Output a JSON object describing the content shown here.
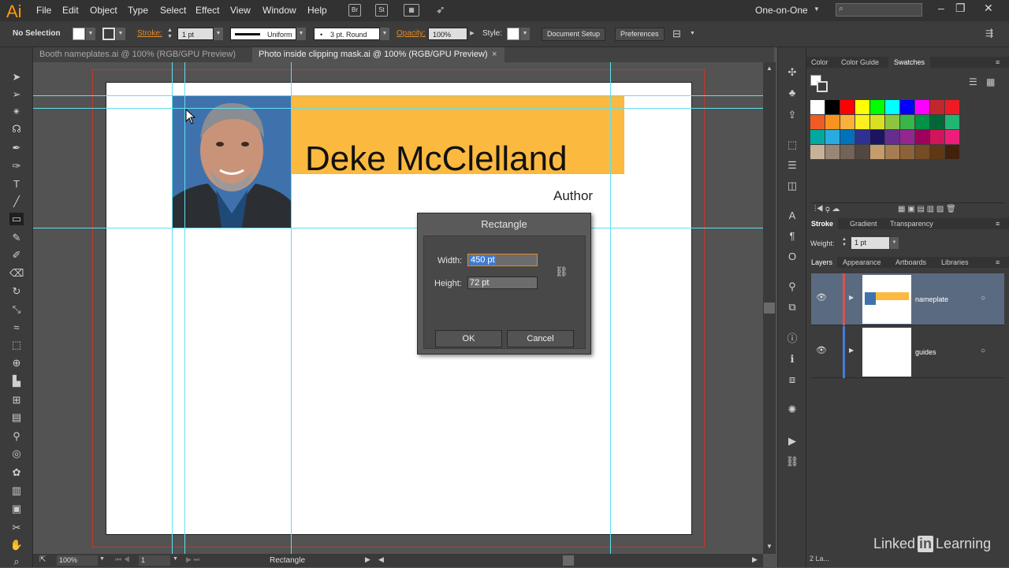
{
  "app": {
    "logo": "Ai",
    "brand_color": "#ff9a00"
  },
  "menu": [
    "File",
    "Edit",
    "Object",
    "Type",
    "Select",
    "Effect",
    "View",
    "Window",
    "Help"
  ],
  "menubar_icons": {
    "bridge": "Br",
    "stock": "St"
  },
  "workspace": "One-on-One",
  "control": {
    "selection": "No Selection",
    "stroke_label": "Stroke:",
    "stroke_weight": "1 pt",
    "profile": "Uniform",
    "brush": "3 pt. Round",
    "opacity_label": "Opacity:",
    "opacity": "100%",
    "style_label": "Style:",
    "document_setup": "Document Setup",
    "preferences": "Preferences"
  },
  "tabs": [
    {
      "label": "Booth nameplates.ai @ 100% (RGB/GPU Preview)",
      "active": false
    },
    {
      "label": "Photo inside clipping mask.ai @ 100% (RGB/GPU Preview)",
      "active": true
    }
  ],
  "artwork": {
    "name": "Deke McClelland",
    "role": "Author",
    "accent": "#fbb93f"
  },
  "dialog": {
    "title": "Rectangle",
    "width_label": "Width:",
    "width_value": "450 pt",
    "height_label": "Height:",
    "height_value": "72 pt",
    "ok": "OK",
    "cancel": "Cancel"
  },
  "swatch_tabs": [
    "Color",
    "Color Guide",
    "Swatches"
  ],
  "stroke_tabs": [
    "Stroke",
    "Gradient",
    "Transparency"
  ],
  "stroke_panel": {
    "weight_label": "Weight:",
    "weight": "1 pt"
  },
  "layer_tabs": [
    "Layers",
    "Appearance",
    "Artboards",
    "Libraries"
  ],
  "layers": [
    {
      "name": "nameplate",
      "color": "#d9534f",
      "selected": true
    },
    {
      "name": "guides",
      "color": "#4a7bd8",
      "selected": false
    }
  ],
  "layers_count": "2 La...",
  "status": {
    "zoom": "100%",
    "artboard": "1",
    "tool": "Rectangle"
  },
  "watermark": {
    "pre": "Linked",
    "in": "in",
    "post": "Learning"
  },
  "swatch_colors": [
    "#ffffff",
    "#000000",
    "#ff0000",
    "#ffff00",
    "#00ff00",
    "#00ffff",
    "#0000ff",
    "#ff00ff",
    "#c1272d",
    "#ed1c24",
    "#f15a24",
    "#f7931e",
    "#fbb03b",
    "#fcee21",
    "#d9e021",
    "#8cc63f",
    "#39b54a",
    "#009245",
    "#006837",
    "#22b573",
    "#00a99d",
    "#29abe2",
    "#0071bc",
    "#2e3192",
    "#1b1464",
    "#662d91",
    "#93278f",
    "#9e005d",
    "#d4145a",
    "#ed1e79",
    "#c7b299",
    "#998675",
    "#736357",
    "#534741",
    "#c69c6d",
    "#a67c52",
    "#8c6239",
    "#754c24",
    "#603813",
    "#42210b"
  ]
}
